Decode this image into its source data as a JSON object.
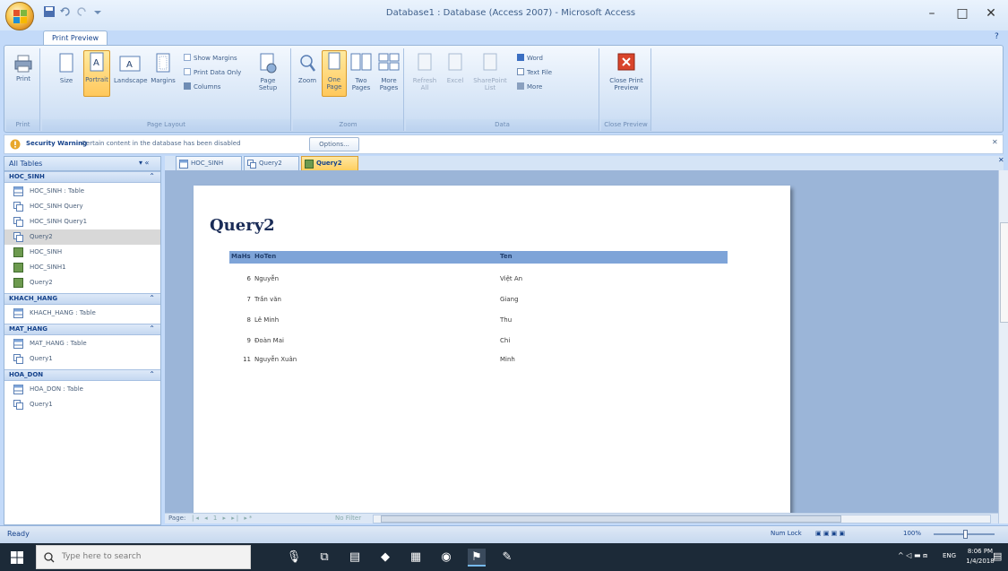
{
  "window": {
    "title": "Database1 : Database (Access 2007) - Microsoft Access",
    "controls": [
      "–",
      "□",
      "✕"
    ]
  },
  "ribbon": {
    "active_tab": "Print Preview",
    "groups": [
      {
        "label": "Print",
        "buttons": [
          "Print"
        ]
      },
      {
        "label": "Page Layout",
        "buttons": [
          "Size",
          "Portrait",
          "Landscape",
          "Margins",
          "Show Margins",
          "Print Data Only",
          "Columns",
          "Page Setup"
        ]
      },
      {
        "label": "Zoom",
        "buttons": [
          "Zoom",
          "One Page",
          "Two Pages",
          "More Pages"
        ]
      },
      {
        "label": "Data",
        "buttons": [
          "Refresh All",
          "Excel",
          "SharePoint List",
          "Word",
          "Text File",
          "More"
        ]
      },
      {
        "label": "Close Preview",
        "buttons": [
          "Close Print Preview"
        ]
      }
    ]
  },
  "security_bar": {
    "title": "Security Warning",
    "message": "Certain content in the database has been disabled",
    "options_label": "Options..."
  },
  "nav_pane": {
    "title": "All Tables",
    "groups": [
      {
        "label": "HOC_SINH",
        "items": [
          {
            "label": "HOC_SINH : Table",
            "icon": "table-icon"
          },
          {
            "label": "HOC_SINH Query",
            "icon": "query-icon"
          },
          {
            "label": "HOC_SINH Query1",
            "icon": "query-icon"
          },
          {
            "label": "Query2",
            "icon": "query-icon",
            "selected": true
          },
          {
            "label": "HOC_SINH",
            "icon": "form-icon"
          },
          {
            "label": "HOC_SINH1",
            "icon": "form-icon"
          },
          {
            "label": "Query2",
            "icon": "form-icon"
          }
        ]
      },
      {
        "label": "KHACH_HANG",
        "items": [
          {
            "label": "KHACH_HANG : Table",
            "icon": "table-icon"
          }
        ]
      },
      {
        "label": "MAT_HANG",
        "items": [
          {
            "label": "MAT_HANG : Table",
            "icon": "table-icon"
          },
          {
            "label": "Query1",
            "icon": "query-icon"
          }
        ]
      },
      {
        "label": "HOA_DON",
        "items": [
          {
            "label": "HOA_DON : Table",
            "icon": "table-icon"
          },
          {
            "label": "Query1",
            "icon": "query-icon"
          }
        ]
      }
    ]
  },
  "doc_tabs": [
    {
      "label": "HOC_SINH",
      "active": false
    },
    {
      "label": "Query2",
      "active": false
    },
    {
      "label": "Query2",
      "active": true
    }
  ],
  "report": {
    "title": "Query2",
    "columns": [
      "MaHs",
      "HoTen",
      "Ten"
    ],
    "rows": [
      {
        "MaHs": "6",
        "HoTen": "Nguyễn",
        "Ten": "Việt An"
      },
      {
        "MaHs": "7",
        "HoTen": "Trần văn",
        "Ten": "Giang"
      },
      {
        "MaHs": "8",
        "HoTen": "Lê Minh",
        "Ten": "Thu"
      },
      {
        "MaHs": "9",
        "HoTen": "Đoàn Mai",
        "Ten": "Chi"
      },
      {
        "MaHs": "11",
        "HoTen": "Nguyễn Xuân",
        "Ten": "Minh"
      }
    ]
  },
  "record_nav": {
    "label": "Page:",
    "page": "1",
    "filter": "No Filter"
  },
  "status": {
    "text": "Ready",
    "numlock": "Num Lock",
    "zoom": "100%"
  },
  "taskbar": {
    "search_placeholder": "Type here to search",
    "language": "ENG",
    "time": "8:06 PM",
    "date": "1/4/2018"
  },
  "colors": {
    "ribbon_active": "#ffc85c",
    "report_header": "#7ea4d8",
    "preview_bg": "#9bb5d8"
  }
}
